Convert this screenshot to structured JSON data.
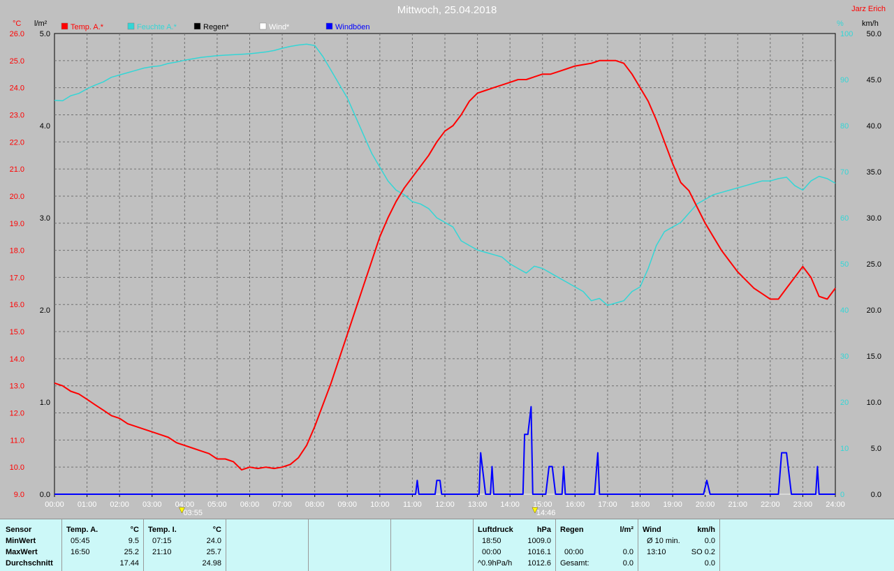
{
  "header": {
    "title": "Mittwoch, 25.04.2018",
    "author": "Jarz Erich"
  },
  "colors": {
    "temp": "#ff0000",
    "humidity": "#33d6d6",
    "rain": "#000000",
    "wind": "#ffffff",
    "gust": "#0000ff",
    "background": "#c0c0c0",
    "table_bg": "#ccf8f8"
  },
  "axes": {
    "left_unit": "°C",
    "rain_unit": "l/m²",
    "right_unit1": "%",
    "right_unit2": "km/h",
    "temp_ticks": [
      "26.0",
      "25.0",
      "24.0",
      "23.0",
      "22.0",
      "21.0",
      "20.0",
      "19.0",
      "18.0",
      "17.0",
      "16.0",
      "15.0",
      "14.0",
      "13.0",
      "12.0",
      "11.0",
      "10.0",
      "9.0"
    ],
    "rain_ticks": [
      "5.0",
      "4.0",
      "3.0",
      "2.0",
      "1.0",
      "0.0"
    ],
    "humidity_ticks": [
      "100",
      "90",
      "80",
      "70",
      "60",
      "50",
      "40",
      "30",
      "20",
      "10",
      "0"
    ],
    "wind_ticks": [
      "50.0",
      "45.0",
      "40.0",
      "35.0",
      "30.0",
      "25.0",
      "20.0",
      "15.0",
      "10.0",
      "5.0",
      "0.0"
    ],
    "x_ticks": [
      "00:00",
      "01:00",
      "02:00",
      "03:00",
      "04:00",
      "05:00",
      "06:00",
      "07:00",
      "08:00",
      "09:00",
      "10:00",
      "11:00",
      "12:00",
      "13:00",
      "14:00",
      "15:00",
      "16:00",
      "17:00",
      "18:00",
      "19:00",
      "20:00",
      "21:00",
      "22:00",
      "23:00",
      "24:00"
    ],
    "sunrise": "03:55",
    "sunset": "14:46"
  },
  "legend": [
    {
      "label": "Temp. A.*",
      "color": "#ff0000"
    },
    {
      "label": "Feuchte A.*",
      "color": "#33d6d6"
    },
    {
      "label": "Regen*",
      "color": "#000000"
    },
    {
      "label": "Wind*",
      "color": "#ffffff"
    },
    {
      "label": "Windböen",
      "color": "#0000ff"
    }
  ],
  "chart_data": {
    "type": "line",
    "title": "Mittwoch, 25.04.2018",
    "x_unit": "hours",
    "temp_range": [
      9,
      26
    ],
    "rain_range": [
      0,
      5
    ],
    "humidity_range": [
      0,
      100
    ],
    "wind_range": [
      0,
      50
    ],
    "grid": true,
    "series": [
      {
        "name": "Temp. A.*",
        "axis": "temp",
        "points": [
          [
            0,
            13.1
          ],
          [
            0.25,
            13.0
          ],
          [
            0.5,
            12.8
          ],
          [
            0.75,
            12.7
          ],
          [
            1,
            12.5
          ],
          [
            1.25,
            12.3
          ],
          [
            1.5,
            12.1
          ],
          [
            1.75,
            11.9
          ],
          [
            2,
            11.8
          ],
          [
            2.25,
            11.6
          ],
          [
            2.5,
            11.5
          ],
          [
            2.75,
            11.4
          ],
          [
            3,
            11.3
          ],
          [
            3.25,
            11.2
          ],
          [
            3.5,
            11.1
          ],
          [
            3.75,
            10.9
          ],
          [
            4,
            10.8
          ],
          [
            4.25,
            10.7
          ],
          [
            4.5,
            10.6
          ],
          [
            4.75,
            10.5
          ],
          [
            5,
            10.3
          ],
          [
            5.25,
            10.3
          ],
          [
            5.5,
            10.2
          ],
          [
            5.75,
            9.9
          ],
          [
            6,
            10.0
          ],
          [
            6.25,
            9.95
          ],
          [
            6.5,
            10.0
          ],
          [
            6.75,
            9.95
          ],
          [
            7,
            10.0
          ],
          [
            7.25,
            10.1
          ],
          [
            7.5,
            10.35
          ],
          [
            7.75,
            10.8
          ],
          [
            8,
            11.5
          ],
          [
            8.25,
            12.3
          ],
          [
            8.5,
            13.1
          ],
          [
            8.75,
            14.0
          ],
          [
            9,
            14.9
          ],
          [
            9.25,
            15.8
          ],
          [
            9.5,
            16.7
          ],
          [
            9.75,
            17.6
          ],
          [
            10,
            18.5
          ],
          [
            10.25,
            19.2
          ],
          [
            10.5,
            19.8
          ],
          [
            10.75,
            20.3
          ],
          [
            11,
            20.7
          ],
          [
            11.25,
            21.1
          ],
          [
            11.5,
            21.5
          ],
          [
            11.75,
            22.0
          ],
          [
            12,
            22.4
          ],
          [
            12.25,
            22.6
          ],
          [
            12.5,
            23.0
          ],
          [
            12.75,
            23.5
          ],
          [
            13,
            23.8
          ],
          [
            13.25,
            23.9
          ],
          [
            13.5,
            24.0
          ],
          [
            13.75,
            24.1
          ],
          [
            14,
            24.2
          ],
          [
            14.25,
            24.3
          ],
          [
            14.5,
            24.3
          ],
          [
            14.75,
            24.4
          ],
          [
            15,
            24.5
          ],
          [
            15.25,
            24.5
          ],
          [
            15.5,
            24.6
          ],
          [
            15.75,
            24.7
          ],
          [
            16,
            24.8
          ],
          [
            16.25,
            24.85
          ],
          [
            16.5,
            24.9
          ],
          [
            16.75,
            25.0
          ],
          [
            17,
            25.0
          ],
          [
            17.25,
            25.0
          ],
          [
            17.5,
            24.9
          ],
          [
            17.75,
            24.5
          ],
          [
            18,
            24.0
          ],
          [
            18.25,
            23.5
          ],
          [
            18.5,
            22.8
          ],
          [
            18.75,
            22.0
          ],
          [
            19,
            21.2
          ],
          [
            19.25,
            20.5
          ],
          [
            19.5,
            20.2
          ],
          [
            19.75,
            19.6
          ],
          [
            20,
            19.0
          ],
          [
            20.25,
            18.5
          ],
          [
            20.5,
            18.0
          ],
          [
            20.75,
            17.6
          ],
          [
            21,
            17.2
          ],
          [
            21.25,
            16.9
          ],
          [
            21.5,
            16.6
          ],
          [
            21.75,
            16.4
          ],
          [
            22,
            16.2
          ],
          [
            22.25,
            16.2
          ],
          [
            22.5,
            16.6
          ],
          [
            22.75,
            17.0
          ],
          [
            23,
            17.4
          ],
          [
            23.25,
            17.0
          ],
          [
            23.5,
            16.3
          ],
          [
            23.75,
            16.2
          ],
          [
            24,
            16.6
          ]
        ]
      },
      {
        "name": "Feuchte A.*",
        "axis": "humidity",
        "points": [
          [
            0,
            85.5
          ],
          [
            0.25,
            85.4
          ],
          [
            0.5,
            86.5
          ],
          [
            0.75,
            87.0
          ],
          [
            1,
            88.0
          ],
          [
            1.25,
            88.8
          ],
          [
            1.5,
            89.5
          ],
          [
            1.75,
            90.5
          ],
          [
            2,
            91.0
          ],
          [
            2.25,
            91.5
          ],
          [
            2.5,
            92.0
          ],
          [
            2.75,
            92.5
          ],
          [
            3,
            92.8
          ],
          [
            3.25,
            93.0
          ],
          [
            3.5,
            93.5
          ],
          [
            3.75,
            93.8
          ],
          [
            4,
            94.2
          ],
          [
            4.25,
            94.5
          ],
          [
            4.5,
            94.8
          ],
          [
            4.75,
            95.0
          ],
          [
            5,
            95.2
          ],
          [
            5.25,
            95.3
          ],
          [
            5.5,
            95.4
          ],
          [
            5.75,
            95.5
          ],
          [
            6,
            95.6
          ],
          [
            6.25,
            95.8
          ],
          [
            6.5,
            96.0
          ],
          [
            6.75,
            96.3
          ],
          [
            7,
            96.8
          ],
          [
            7.25,
            97.2
          ],
          [
            7.5,
            97.5
          ],
          [
            7.75,
            97.7
          ],
          [
            8,
            97.4
          ],
          [
            8.25,
            95.0
          ],
          [
            8.5,
            92.0
          ],
          [
            8.75,
            89.0
          ],
          [
            9,
            86.0
          ],
          [
            9.25,
            82.0
          ],
          [
            9.5,
            78.0
          ],
          [
            9.75,
            74.0
          ],
          [
            10,
            71.0
          ],
          [
            10.25,
            68.0
          ],
          [
            10.5,
            66.0
          ],
          [
            10.75,
            65.0
          ],
          [
            11,
            63.5
          ],
          [
            11.25,
            63.0
          ],
          [
            11.5,
            62.0
          ],
          [
            11.75,
            60.0
          ],
          [
            12,
            59.0
          ],
          [
            12.25,
            58.0
          ],
          [
            12.5,
            55.0
          ],
          [
            12.75,
            54.0
          ],
          [
            13,
            53.0
          ],
          [
            13.25,
            52.5
          ],
          [
            13.5,
            52.0
          ],
          [
            13.75,
            51.5
          ],
          [
            14,
            50.0
          ],
          [
            14.25,
            49.0
          ],
          [
            14.5,
            48.0
          ],
          [
            14.75,
            49.5
          ],
          [
            15,
            49.0
          ],
          [
            15.25,
            48.0
          ],
          [
            15.5,
            47.0
          ],
          [
            15.75,
            46.0
          ],
          [
            16,
            45.0
          ],
          [
            16.25,
            44.0
          ],
          [
            16.5,
            42.0
          ],
          [
            16.75,
            42.5
          ],
          [
            17,
            41.0
          ],
          [
            17.25,
            41.5
          ],
          [
            17.5,
            42.0
          ],
          [
            17.75,
            44.0
          ],
          [
            18,
            45.0
          ],
          [
            18.25,
            49.0
          ],
          [
            18.5,
            54.0
          ],
          [
            18.75,
            57.0
          ],
          [
            19,
            58.0
          ],
          [
            19.25,
            59.0
          ],
          [
            19.5,
            61.0
          ],
          [
            19.75,
            63.0
          ],
          [
            20,
            64.0
          ],
          [
            20.25,
            65.0
          ],
          [
            20.5,
            65.5
          ],
          [
            20.75,
            66.0
          ],
          [
            21,
            66.5
          ],
          [
            21.25,
            67.0
          ],
          [
            21.5,
            67.5
          ],
          [
            21.75,
            68.0
          ],
          [
            22,
            68.0
          ],
          [
            22.25,
            68.5
          ],
          [
            22.5,
            68.8
          ],
          [
            22.75,
            67.0
          ],
          [
            23,
            66.0
          ],
          [
            23.25,
            68.0
          ],
          [
            23.5,
            69.0
          ],
          [
            23.75,
            68.5
          ],
          [
            24,
            67.5
          ]
        ]
      },
      {
        "name": "Windböen",
        "axis": "wind",
        "points": [
          [
            0,
            0
          ],
          [
            11.1,
            0
          ],
          [
            11.15,
            1.5
          ],
          [
            11.2,
            0
          ],
          [
            11.7,
            0
          ],
          [
            11.75,
            1.5
          ],
          [
            11.85,
            1.5
          ],
          [
            11.9,
            0
          ],
          [
            13.05,
            0
          ],
          [
            13.1,
            4.5
          ],
          [
            13.2,
            1.5
          ],
          [
            13.25,
            0
          ],
          [
            13.4,
            0
          ],
          [
            13.45,
            3.0
          ],
          [
            13.5,
            0
          ],
          [
            14.4,
            0
          ],
          [
            14.45,
            6.5
          ],
          [
            14.55,
            6.5
          ],
          [
            14.65,
            9.5
          ],
          [
            14.7,
            0
          ],
          [
            15.1,
            0
          ],
          [
            15.2,
            3.0
          ],
          [
            15.3,
            3.0
          ],
          [
            15.4,
            0
          ],
          [
            15.6,
            0
          ],
          [
            15.65,
            3.0
          ],
          [
            15.7,
            0
          ],
          [
            16.6,
            0
          ],
          [
            16.7,
            4.5
          ],
          [
            16.75,
            0
          ],
          [
            19.95,
            0
          ],
          [
            20.05,
            1.5
          ],
          [
            20.15,
            0
          ],
          [
            22.25,
            0
          ],
          [
            22.35,
            4.5
          ],
          [
            22.5,
            4.5
          ],
          [
            22.65,
            0
          ],
          [
            23.4,
            0
          ],
          [
            23.45,
            3.0
          ],
          [
            23.5,
            0
          ],
          [
            24,
            0
          ]
        ]
      },
      {
        "name": "Regen*",
        "axis": "rain",
        "points": [
          [
            0,
            0
          ],
          [
            24,
            0
          ]
        ]
      },
      {
        "name": "Wind*",
        "axis": "wind",
        "points": [
          [
            0,
            0
          ],
          [
            24,
            0
          ]
        ]
      }
    ]
  },
  "table": {
    "sensor": {
      "header": "Sensor",
      "rows": [
        "MinWert",
        "MaxWert",
        "Durchschnitt"
      ]
    },
    "temp_a": {
      "header": "Temp. A.",
      "unit": "°C",
      "min_time": "05:45",
      "min_val": "9.5",
      "max_time": "16:50",
      "max_val": "25.2",
      "avg": "17.44"
    },
    "temp_i": {
      "header": "Temp. I.",
      "unit": "°C",
      "min_time": "07:15",
      "min_val": "24.0",
      "max_time": "21:10",
      "max_val": "25.7",
      "avg": "24.98"
    },
    "pressure": {
      "header": "Luftdruck",
      "unit": "hPa",
      "min_time": "18:50",
      "min_val": "1009.0",
      "max_time": "00:00",
      "max_val": "1016.1",
      "trend": "^0.9hPa/h",
      "trend_val": "1012.6"
    },
    "rain": {
      "header": "Regen",
      "unit": "l/m²",
      "time": "00:00",
      "val1": "0.0",
      "total_label": "Gesamt:",
      "total": "0.0"
    },
    "wind": {
      "header": "Wind",
      "unit": "km/h",
      "avg_label": "Ø 10 min.",
      "avg_val": "0.0",
      "max_time": "13:10",
      "max_val": "SO 0.2",
      "val3": "0.0"
    }
  }
}
